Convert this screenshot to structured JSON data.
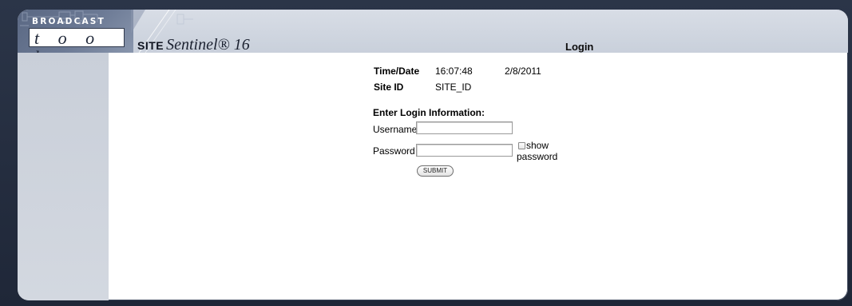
{
  "brand": {
    "logo_top": "BROADCAST",
    "logo_bottom": "t o o l s",
    "product_prefix": "SITE",
    "product_name": "Sentinel® 16"
  },
  "page": {
    "heading": "Login"
  },
  "info": {
    "time_date_label": "Time/Date",
    "time_value": "16:07:48",
    "date_value": "2/8/2011",
    "site_id_label": "Site ID",
    "site_id_value": "SITE_ID"
  },
  "login": {
    "section_title": "Enter Login Information:",
    "username_label": "Username",
    "username_value": "",
    "password_label": "Password",
    "password_value": "",
    "show_password_label": "show password",
    "show_password_checked": false,
    "submit_label": "SUBMIT"
  },
  "colors": {
    "frame": "#2b3548",
    "header": "#d8dde6",
    "sidebar": "#c9cfd9",
    "logo_bg": "#5a6883"
  }
}
